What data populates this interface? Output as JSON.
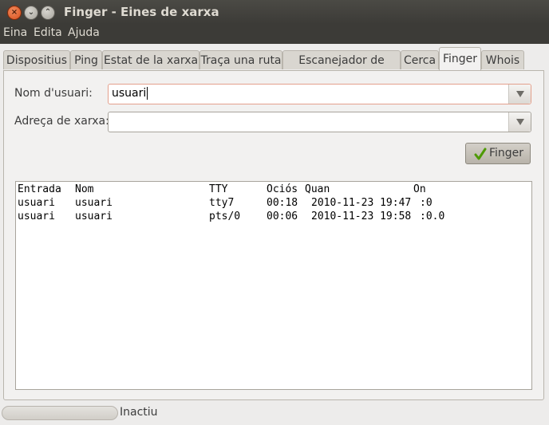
{
  "window": {
    "title": "Finger - Eines de xarxa"
  },
  "window_controls": {
    "close": "×",
    "minimize": "⌄",
    "maximize": "⌃"
  },
  "menubar": {
    "items": [
      "Eina",
      "Edita",
      "Ajuda"
    ]
  },
  "tabs": [
    {
      "label": "Dispositius",
      "active": false
    },
    {
      "label": "Ping",
      "active": false
    },
    {
      "label": "Estat de la xarxa",
      "active": false
    },
    {
      "label": "Traça una ruta",
      "active": false
    },
    {
      "label": "Escanejador de ports",
      "active": false
    },
    {
      "label": "Cerca",
      "active": false
    },
    {
      "label": "Finger",
      "active": true
    },
    {
      "label": "Whois",
      "active": false
    }
  ],
  "form": {
    "username_label": "Nom d'usuari:",
    "username_value": "usuari",
    "address_label": "Adreça de xarxa:",
    "address_value": "",
    "finger_button": "Finger"
  },
  "output": {
    "headers": [
      "Entrada",
      "Nom",
      "TTY",
      "Ociós",
      "Quan",
      "On"
    ],
    "rows": [
      [
        "usuari",
        "usuari",
        "tty7",
        "00:18",
        "2010-11-23 19:47",
        ":0"
      ],
      [
        "usuari",
        "usuari",
        "pts/0",
        "00:06",
        "2010-11-23 19:58",
        ":0.0"
      ]
    ]
  },
  "status": {
    "text": "Inactiu"
  },
  "colors": {
    "titlebar": "#3c3b37",
    "window_bg": "#edeceb",
    "close_button": "#e05a25",
    "check_icon": "#4e9a06"
  }
}
